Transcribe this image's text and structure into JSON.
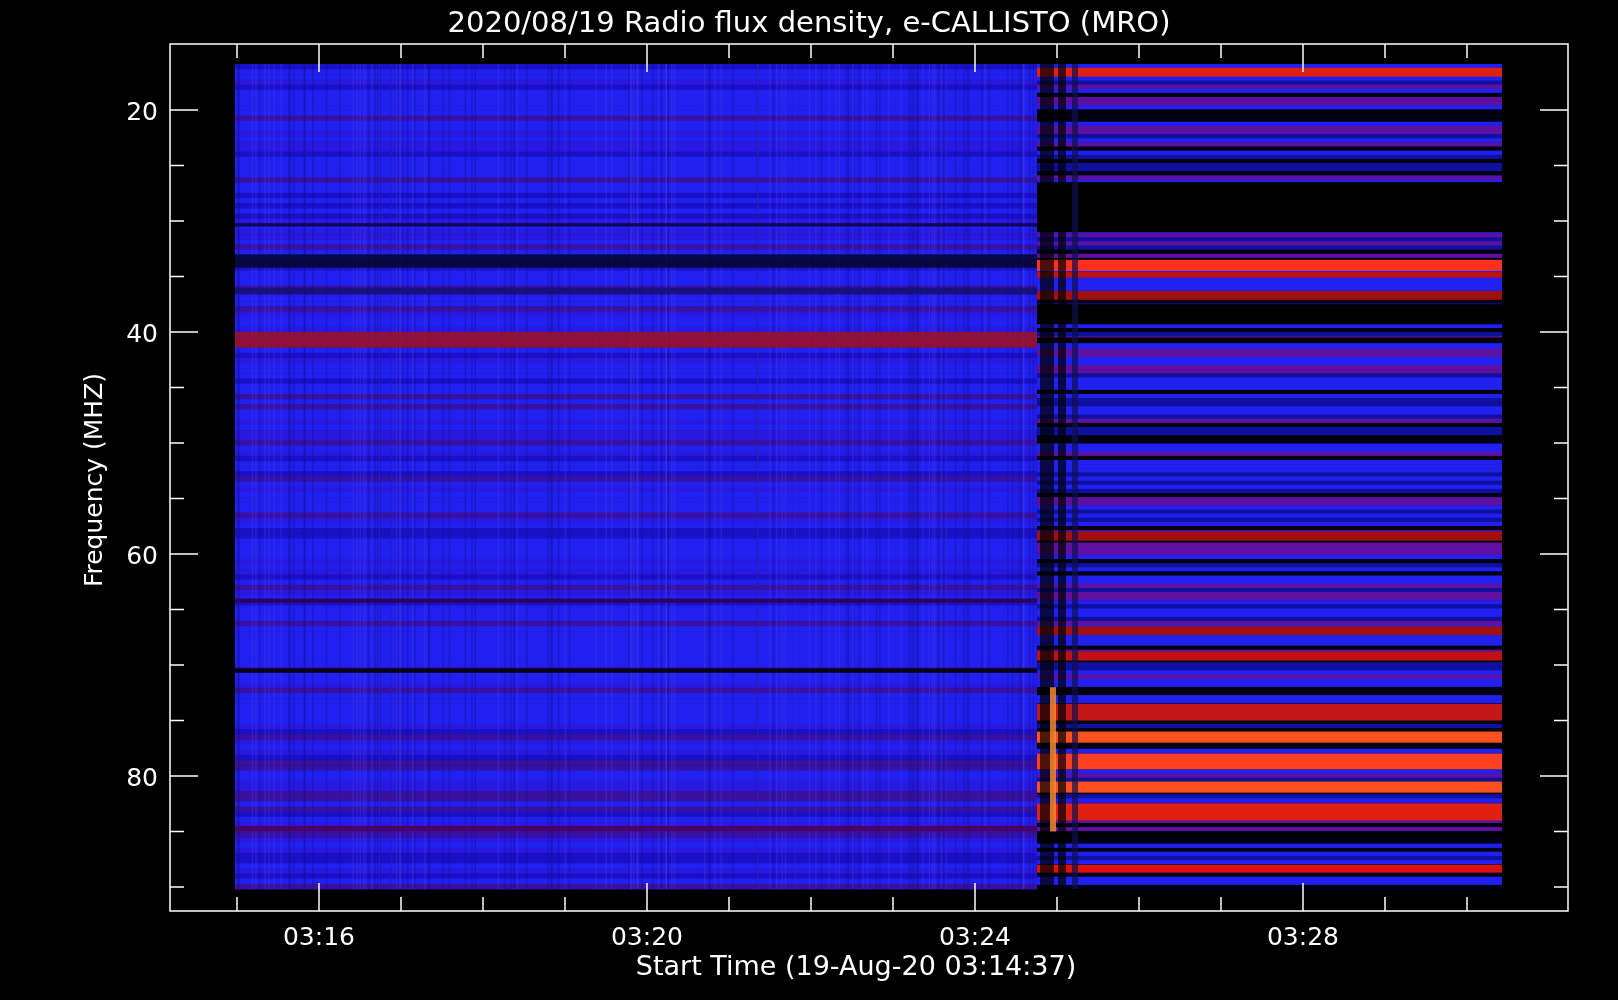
{
  "title": "2020/08/19  Radio flux density, e-CALLISTO (MRO)",
  "ylabel": "Frequency (MHZ)",
  "xlabel": "Start Time (19-Aug-20 03:14:37)",
  "yticks": [
    "20",
    "40",
    "60",
    "80"
  ],
  "xticks": [
    "03:16",
    "03:20",
    "03:24",
    "03:28"
  ]
}
